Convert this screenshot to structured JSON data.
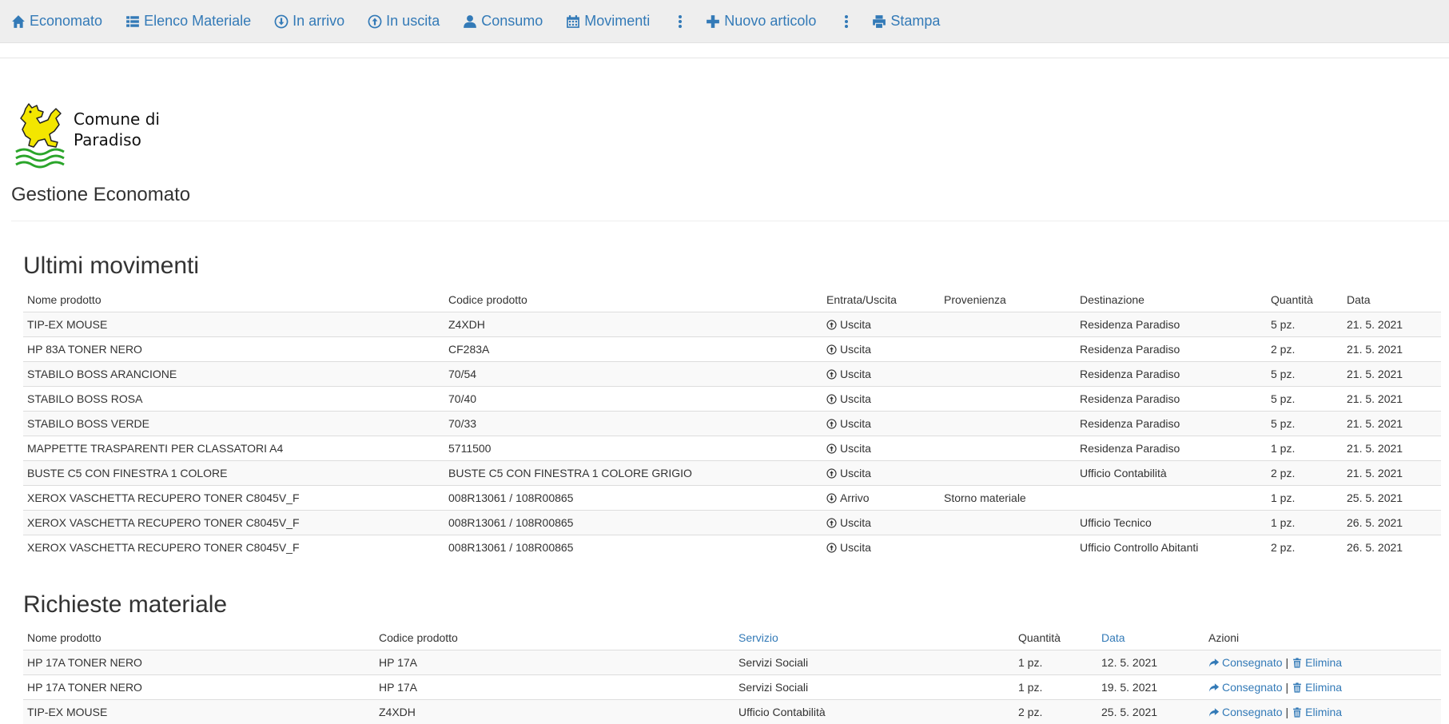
{
  "nav": {
    "items": [
      {
        "label": "Economato",
        "icon": "home-icon"
      },
      {
        "label": "Elenco Materiale",
        "icon": "list-icon"
      },
      {
        "label": "In arrivo",
        "icon": "arrow-down-circle-icon"
      },
      {
        "label": "In uscita",
        "icon": "arrow-up-circle-icon"
      },
      {
        "label": "Consumo",
        "icon": "user-icon"
      },
      {
        "label": "Movimenti",
        "icon": "calendar-icon"
      },
      {
        "label": "Nuovo articolo",
        "icon": "plus-icon"
      },
      {
        "label": "Stampa",
        "icon": "print-icon"
      }
    ]
  },
  "header": {
    "logo_text_line1": "Comune di",
    "logo_text_line2": "Paradiso",
    "subtitle": "Gestione Economato"
  },
  "movements": {
    "title": "Ultimi movimenti",
    "columns": [
      "Nome prodotto",
      "Codice prodotto",
      "Entrata/Uscita",
      "Provenienza",
      "Destinazione",
      "Quantità",
      "Data"
    ],
    "rows": [
      {
        "name": "TIP-EX MOUSE",
        "code": "Z4XDH",
        "dir": "Uscita",
        "from": "",
        "to": "Residenza Paradiso",
        "qty": "5 pz.",
        "date": "21. 5. 2021"
      },
      {
        "name": "HP 83A TONER NERO",
        "code": "CF283A",
        "dir": "Uscita",
        "from": "",
        "to": "Residenza Paradiso",
        "qty": "2 pz.",
        "date": "21. 5. 2021"
      },
      {
        "name": "STABILO BOSS ARANCIONE",
        "code": "70/54",
        "dir": "Uscita",
        "from": "",
        "to": "Residenza Paradiso",
        "qty": "5 pz.",
        "date": "21. 5. 2021"
      },
      {
        "name": "STABILO BOSS ROSA",
        "code": "70/40",
        "dir": "Uscita",
        "from": "",
        "to": "Residenza Paradiso",
        "qty": "5 pz.",
        "date": "21. 5. 2021"
      },
      {
        "name": "STABILO BOSS VERDE",
        "code": "70/33",
        "dir": "Uscita",
        "from": "",
        "to": "Residenza Paradiso",
        "qty": "5 pz.",
        "date": "21. 5. 2021"
      },
      {
        "name": "MAPPETTE TRASPARENTI PER CLASSATORI A4",
        "code": "5711500",
        "dir": "Uscita",
        "from": "",
        "to": "Residenza Paradiso",
        "qty": "1 pz.",
        "date": "21. 5. 2021"
      },
      {
        "name": "BUSTE C5 CON FINESTRA 1 COLORE",
        "code": "BUSTE C5 CON FINESTRA 1 COLORE GRIGIO",
        "dir": "Uscita",
        "from": "",
        "to": "Ufficio Contabilità",
        "qty": "2 pz.",
        "date": "21. 5. 2021"
      },
      {
        "name": "XEROX VASCHETTA RECUPERO TONER C8045V_F",
        "code": "008R13061 / 108R00865",
        "dir": "Arrivo",
        "from": "Storno materiale",
        "to": "",
        "qty": "1 pz.",
        "date": "25. 5. 2021"
      },
      {
        "name": "XEROX VASCHETTA RECUPERO TONER C8045V_F",
        "code": "008R13061 / 108R00865",
        "dir": "Uscita",
        "from": "",
        "to": "Ufficio Tecnico",
        "qty": "1 pz.",
        "date": "26. 5. 2021"
      },
      {
        "name": "XEROX VASCHETTA RECUPERO TONER C8045V_F",
        "code": "008R13061 / 108R00865",
        "dir": "Uscita",
        "from": "",
        "to": "Ufficio Controllo Abitanti",
        "qty": "2 pz.",
        "date": "26. 5. 2021"
      }
    ]
  },
  "requests": {
    "title": "Richieste materiale",
    "columns": [
      "Nome prodotto",
      "Codice prodotto",
      "Servizio",
      "Quantità",
      "Data",
      "Azioni"
    ],
    "action_deliver": "Consegnato",
    "action_separator": "|",
    "action_delete": "Elimina",
    "rows": [
      {
        "name": "HP 17A TONER NERO",
        "code": "HP 17A",
        "service": "Servizi Sociali",
        "qty": "1 pz.",
        "date": "12. 5. 2021"
      },
      {
        "name": "HP 17A TONER NERO",
        "code": "HP 17A",
        "service": "Servizi Sociali",
        "qty": "1 pz.",
        "date": "19. 5. 2021"
      },
      {
        "name": "TIP-EX MOUSE",
        "code": "Z4XDH",
        "service": "Ufficio Contabilità",
        "qty": "2 pz.",
        "date": "25. 5. 2021"
      }
    ]
  },
  "colors": {
    "link": "#337ab7",
    "nav_bg": "#eeeeee",
    "logo_yellow": "#f3e600",
    "logo_green": "#2aa52a"
  }
}
